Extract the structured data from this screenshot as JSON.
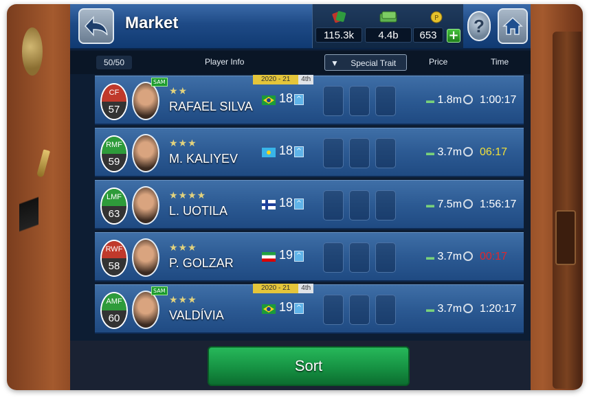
{
  "topbar": {
    "title": "Market",
    "stats": [
      {
        "icon": "players-icon",
        "value": "115.3k"
      },
      {
        "icon": "cash-icon",
        "value": "4.4b"
      },
      {
        "icon": "coin-icon",
        "value": "653"
      }
    ],
    "plus": "+",
    "help": "?"
  },
  "header": {
    "count": "50/50",
    "player_info": "Player Info",
    "special_trait": "Special Trait",
    "special_trait_arrow": "▼",
    "price": "Price",
    "time": "Time"
  },
  "rows": [
    {
      "pos": "CF",
      "rating": "57",
      "pos_color": "red",
      "sam": "SAM",
      "stars": "★★",
      "name": "RAFAEL SILVA",
      "season": "2020 - 21",
      "place": "4th",
      "flag": "brazil",
      "age": "18",
      "price": "1.8m",
      "time": "1:00:17",
      "time_color": "#ffffff"
    },
    {
      "pos": "RMF",
      "rating": "59",
      "pos_color": "green",
      "sam": "",
      "stars": "★★★",
      "name": "M. KALIYEV",
      "season": "",
      "place": "",
      "flag": "kazakhstan",
      "age": "18",
      "price": "3.7m",
      "time": "06:17",
      "time_color": "#f1e03a"
    },
    {
      "pos": "LMF",
      "rating": "63",
      "pos_color": "green",
      "sam": "",
      "stars": "★★★★",
      "name": "L. UOTILA",
      "season": "",
      "place": "",
      "flag": "finland",
      "age": "18",
      "price": "7.5m",
      "time": "1:56:17",
      "time_color": "#ffffff"
    },
    {
      "pos": "RWF",
      "rating": "58",
      "pos_color": "red",
      "sam": "",
      "stars": "★★★",
      "name": "P. GOLZAR",
      "season": "",
      "place": "",
      "flag": "iran",
      "age": "19",
      "price": "3.7m",
      "time": "00:17",
      "time_color": "#e0262b"
    },
    {
      "pos": "AMF",
      "rating": "60",
      "pos_color": "green",
      "sam": "SAM",
      "stars": "★★★",
      "name": "VALDÍVIA",
      "season": "2020 - 21",
      "place": "4th",
      "flag": "brazil",
      "age": "19",
      "price": "3.7m",
      "time": "1:20:17",
      "time_color": "#ffffff"
    }
  ],
  "row_arrow": "^",
  "footer": {
    "sort": "Sort"
  }
}
